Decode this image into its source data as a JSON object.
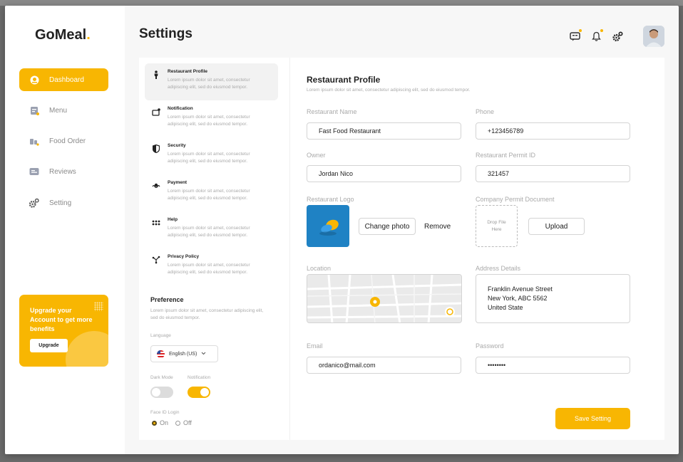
{
  "app": {
    "logo_text": "GoMeal",
    "logo_dot": ".",
    "accent_color": "#f8b602"
  },
  "sidebar": {
    "items": [
      {
        "label": "Dashboard",
        "icon": "dashboard-icon",
        "active": true
      },
      {
        "label": "Menu",
        "icon": "menu-icon",
        "active": false
      },
      {
        "label": "Food Order",
        "icon": "food-order-icon",
        "active": false
      },
      {
        "label": "Reviews",
        "icon": "reviews-icon",
        "active": false
      },
      {
        "label": "Setting",
        "icon": "setting-icon",
        "active": false
      }
    ],
    "upgrade": {
      "text": "Upgrade your Account to get more benefits",
      "button": "Upgrade"
    }
  },
  "header": {
    "title": "Settings",
    "icons": [
      "chat-icon",
      "bell-icon",
      "gear-icon"
    ]
  },
  "settings_menu": {
    "items": [
      {
        "title": "Restaurant Profile",
        "desc": "Lorem ipsum dolor sit amet, consectetur adipiscing elit, sed do eiusmod tempor.",
        "icon": "person-icon",
        "active": true
      },
      {
        "title": "Notification",
        "desc": "Lorem ipsum dolor sit amet, consectetur adipiscing elit, sed do eiusmod tempor.",
        "icon": "notification-icon",
        "active": false
      },
      {
        "title": "Security",
        "desc": "Lorem ipsum dolor sit amet, consectetur adipiscing elit, sed do eiusmod tempor.",
        "icon": "shield-icon",
        "active": false
      },
      {
        "title": "Payment",
        "desc": "Lorem ipsum dolor sit amet, consectetur adipiscing elit, sed do eiusmod tempor.",
        "icon": "payment-icon",
        "active": false
      },
      {
        "title": "Help",
        "desc": "Lorem ipsum dolor sit amet, consectetur adipiscing elit, sed do eiusmod tempor.",
        "icon": "help-icon",
        "active": false
      },
      {
        "title": "Privacy Policy",
        "desc": "Lorem ipsum dolor sit amet, consectetur adipiscing elit, sed do eiusmod tempor.",
        "icon": "privacy-icon",
        "active": false
      }
    ],
    "preference": {
      "title": "Preference",
      "desc": "Lorem ipsum dolor sit amet, consectetur adipiscing elit, sed do eiusmod tempor.",
      "language_label": "Language",
      "language_value": "English (US)",
      "dark_mode_label": "Dark Mode",
      "dark_mode_on": false,
      "notification_label": "Notification",
      "notification_on": true,
      "face_id_label": "Face ID Login",
      "face_id_on": "On",
      "face_id_off": "Off",
      "face_id_selected": "On"
    }
  },
  "profile": {
    "title": "Restaurant Profile",
    "desc": "Lorem ipsum dolor sit amet, consectetur adipiscing elit, sed do eiusmod tempor.",
    "restaurant_name_label": "Restaurant Name",
    "restaurant_name_value": "Fast Food Restaurant",
    "phone_label": "Phone",
    "phone_value": "+123456789",
    "owner_label": "Owner",
    "owner_value": "Jordan Nico",
    "permit_id_label": "Restaurant Permit ID",
    "permit_id_value": "321457",
    "logo_label": "Restaurant Logo",
    "change_photo": "Change photo",
    "remove": "Remove",
    "document_label": "Company Permit Document",
    "drop_text": "Drop File Here",
    "upload": "Upload",
    "location_label": "Location",
    "address_label": "Address Details",
    "address_line1": "Franklin Avenue Street",
    "address_line2": "New York, ABC 5562",
    "address_line3": "United State",
    "email_label": "Email",
    "email_value": "ordanico@mail.com",
    "password_label": "Password",
    "password_value": "••••••••",
    "save": "Save Setting"
  }
}
